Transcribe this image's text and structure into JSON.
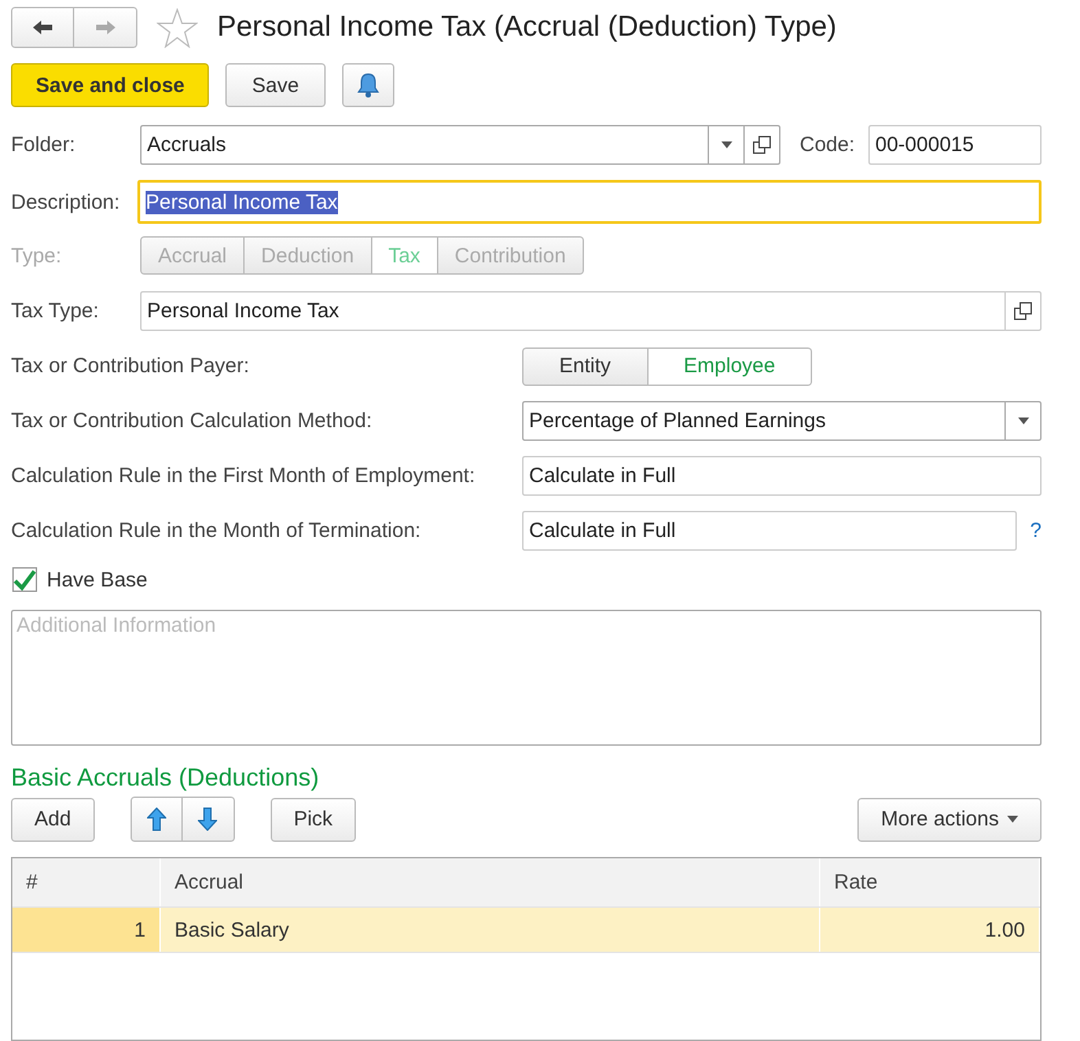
{
  "nav_buttons": [
    {
      "kind": "back",
      "disabled": false
    },
    {
      "kind": "forward",
      "disabled": true
    }
  ],
  "favorite": false,
  "title": "Personal Income Tax (Accrual (Deduction) Type)",
  "toolbar": {
    "primary": "Save and close",
    "secondary": "Save"
  },
  "folder": {
    "label": "Folder:",
    "value": "Accruals"
  },
  "code": {
    "label": "Code:",
    "value": "00-000015"
  },
  "description": {
    "label": "Description:",
    "value": "Personal Income Tax",
    "focused": true
  },
  "type": {
    "label": "Type:",
    "disabled": true,
    "options": [
      {
        "label": "Accrual",
        "selected": false
      },
      {
        "label": "Deduction",
        "selected": false
      },
      {
        "label": "Tax",
        "selected": true
      },
      {
        "label": "Contribution",
        "selected": false
      }
    ]
  },
  "tax_type": {
    "label": "Tax Type:",
    "value": "Personal Income Tax"
  },
  "payer": {
    "label": "Tax or Contribution Payer:",
    "options": [
      {
        "label": "Entity",
        "selected": false
      },
      {
        "label": "Employee",
        "selected": true
      }
    ]
  },
  "method": {
    "label": "Tax or Contribution Calculation Method:",
    "value": "Percentage of Planned Earnings"
  },
  "first_month": {
    "label": "Calculation Rule in the First Month of Employment:",
    "value": "Calculate in Full"
  },
  "termination": {
    "label": "Calculation Rule in the Month of Termination:",
    "value": "Calculate in Full",
    "help": "?"
  },
  "have_base": {
    "label": "Have Base",
    "checked": true
  },
  "additional_info": {
    "placeholder": "Additional Information"
  },
  "section_title": "Basic Accruals (Deductions)",
  "table_toolbar": {
    "add": "Add",
    "pick": "Pick",
    "more": "More actions"
  },
  "table": {
    "columns": [
      "#",
      "Accrual",
      "Rate"
    ],
    "rows": [
      {
        "cells": [
          "1",
          "Basic Salary",
          "1.00"
        ],
        "selected": true
      }
    ]
  }
}
